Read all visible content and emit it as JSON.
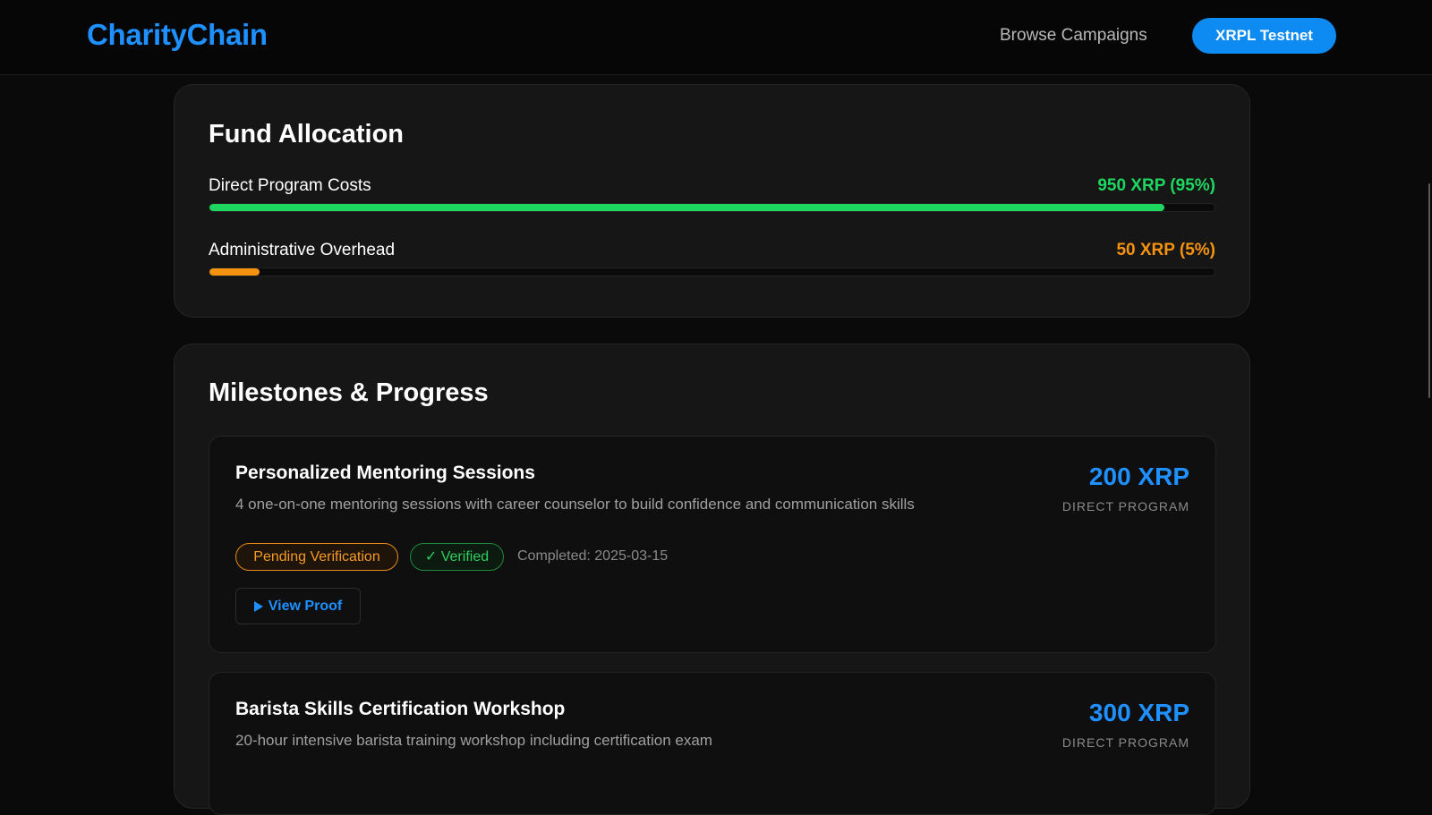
{
  "header": {
    "brand": "CharityChain",
    "nav_link": "Browse Campaigns",
    "network_button": "XRPL Testnet"
  },
  "fund_allocation": {
    "title": "Fund Allocation",
    "rows": [
      {
        "label": "Direct Program Costs",
        "value": "950 XRP (95%)",
        "percent": 95,
        "color": "#1ed760"
      },
      {
        "label": "Administrative Overhead",
        "value": "50 XRP (5%)",
        "percent": 5,
        "color": "#f5920f"
      }
    ]
  },
  "milestones": {
    "title": "Milestones & Progress",
    "items": [
      {
        "title": "Personalized Mentoring Sessions",
        "description": "4 one-on-one mentoring sessions with career counselor to build confidence and communication skills",
        "amount": "200 XRP",
        "type": "DIRECT PROGRAM",
        "status_badge": "Pending Verification",
        "verified_badge": "✓ Verified",
        "completed": "Completed: 2025-03-15",
        "proof_button": "View Proof"
      },
      {
        "title": "Barista Skills Certification Workshop",
        "description": "20-hour intensive barista training workshop including certification exam",
        "amount": "300 XRP",
        "type": "DIRECT PROGRAM"
      }
    ]
  },
  "colors": {
    "accent": "#1e90ff",
    "direct_program": "#1ed760",
    "overhead": "#f5920f",
    "pending": "#f59a23",
    "verified": "#2fce5f"
  }
}
